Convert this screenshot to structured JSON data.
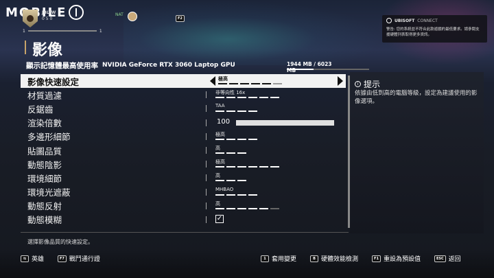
{
  "brand": {
    "text": "MOBILE"
  },
  "player": {
    "name": "JBLTW",
    "stats": "0  5  0",
    "level_left": "1",
    "level_right": "1"
  },
  "network": {
    "label": "NAT"
  },
  "keys": {
    "f2": "F2"
  },
  "ubisoft": {
    "brand": "UBISOFT",
    "connect": "CONNECT",
    "message": "警告: 您的系統並不符合此款遊戲的最低要求。請參閱支援硬體列表取得更多資訊。"
  },
  "page": {
    "title": "影像"
  },
  "vram": {
    "label": "顯示記憶體最高使用率",
    "gpu": "NVIDIA GeForce RTX 3060 Laptop GPU",
    "value": "1944 MB / 6023 MB",
    "fraction": 0.323
  },
  "settings": [
    {
      "label": "影像快速設定",
      "value": "極高",
      "steps": 6,
      "level": 5,
      "selected": true
    },
    {
      "label": "材質過濾",
      "value": "非等向性 16x",
      "steps": 6,
      "level": 6
    },
    {
      "label": "反鋸齒",
      "value": "TAA",
      "steps": 4,
      "level": 4
    },
    {
      "label": "渲染倍數",
      "value": "100",
      "type": "slider",
      "fraction": 1.0
    },
    {
      "label": "多邊形細節",
      "value": "極高",
      "steps": 4,
      "level": 4
    },
    {
      "label": "貼圖品質",
      "value": "高",
      "steps": 3,
      "level": 3
    },
    {
      "label": "動態陰影",
      "value": "極高",
      "steps": 6,
      "level": 6
    },
    {
      "label": "環境細節",
      "value": "高",
      "steps": 3,
      "level": 3
    },
    {
      "label": "環境光遮蔽",
      "value": "MHBAO",
      "steps": 4,
      "level": 4
    },
    {
      "label": "動態反射",
      "value": "高",
      "steps": 6,
      "level": 5
    },
    {
      "label": "動態模糊",
      "value": "☑",
      "type": "checkbox",
      "checked": true
    }
  ],
  "hint": {
    "title": "提示",
    "text": "依據由低到高的電腦等級，設定為建議使用的影像選項。"
  },
  "description": "選擇影像品質的快速設定。",
  "footer": {
    "left": [
      {
        "key": "⇆",
        "label": "英雄"
      },
      {
        "key": "F7",
        "label": "戰鬥通行證"
      }
    ],
    "right": [
      {
        "key": "1",
        "label": "套用變更"
      },
      {
        "key": "B",
        "label": "硬體效能檢測"
      },
      {
        "key": "F1",
        "label": "重設為預設值"
      },
      {
        "key": "ESC",
        "label": "返回"
      }
    ]
  }
}
